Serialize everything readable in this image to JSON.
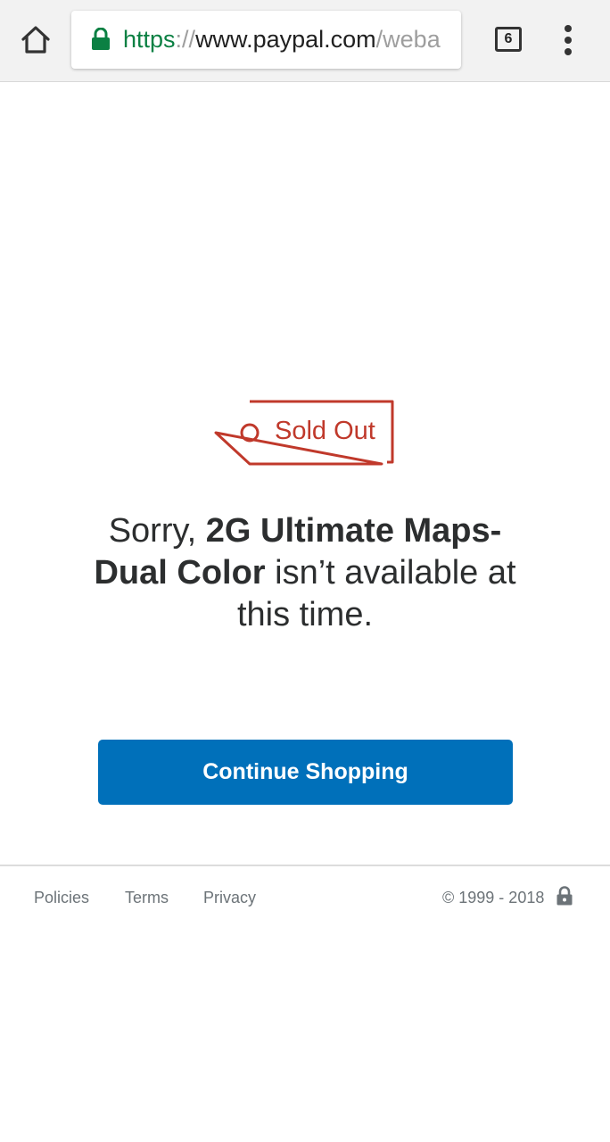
{
  "browser": {
    "url_scheme": "https",
    "url_separator": "://",
    "url_host": "www.paypal.com",
    "url_path": "/weba",
    "tab_count": "6",
    "secure_color": "#0b8043"
  },
  "tag": {
    "label": "Sold Out",
    "color": "#c0392b",
    "icon": "price-tag-icon"
  },
  "message": {
    "prefix": "Sorry, ",
    "product": "2G Ultimate Maps-Dual Color",
    "suffix": " isn’t available at this time."
  },
  "button": {
    "label": "Continue Shopping",
    "color": "#0070ba"
  },
  "footer": {
    "links": [
      "Policies",
      "Terms",
      "Privacy"
    ],
    "copyright": "© 1999 - 2018"
  }
}
